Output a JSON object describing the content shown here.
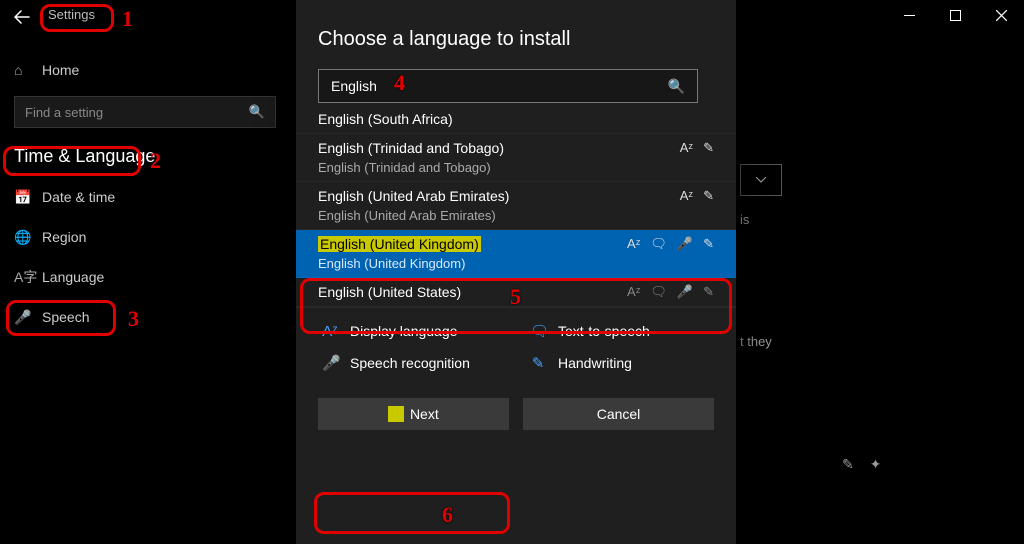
{
  "titlebar": {
    "title": "Settings"
  },
  "sidebar": {
    "home": "Home",
    "search_placeholder": "Find a setting",
    "header": "Time & Language",
    "items": [
      {
        "icon": "📅",
        "label": "Date & time"
      },
      {
        "icon": "🌐",
        "label": "Region"
      },
      {
        "icon": "A字",
        "label": "Language"
      },
      {
        "icon": "🎤",
        "label": "Speech"
      }
    ]
  },
  "dialog": {
    "title": "Choose a language to install",
    "search_value": "English",
    "languages": [
      {
        "name": "English (South Africa)",
        "sub": "",
        "feats": [],
        "half": true,
        "selected": false
      },
      {
        "name": "English (Trinidad and Tobago)",
        "sub": "English (Trinidad and Tobago)",
        "feats": [
          "A",
          "✎"
        ],
        "selected": false
      },
      {
        "name": "English (United Arab Emirates)",
        "sub": "English (United Arab Emirates)",
        "feats": [
          "A",
          "✎"
        ],
        "selected": false
      },
      {
        "name": "English (United Kingdom)",
        "sub": "English (United Kingdom)",
        "feats": [
          "A",
          "🗣",
          "🎤",
          "✎"
        ],
        "selected": true
      },
      {
        "name": "English (United States)",
        "sub": "",
        "feats": [
          "A",
          "🗣",
          "🎤",
          "✎"
        ],
        "selected": false
      }
    ],
    "legend": {
      "display": "Display language",
      "tts": "Text-to-speech",
      "speech": "Speech recognition",
      "handwriting": "Handwriting"
    },
    "next": "Next",
    "cancel": "Cancel"
  },
  "bg": {
    "text1": "is",
    "text2": "t they"
  },
  "ann": {
    "n1": "1",
    "n2": "2",
    "n3": "3",
    "n4": "4",
    "n5": "5",
    "n6": "6"
  }
}
